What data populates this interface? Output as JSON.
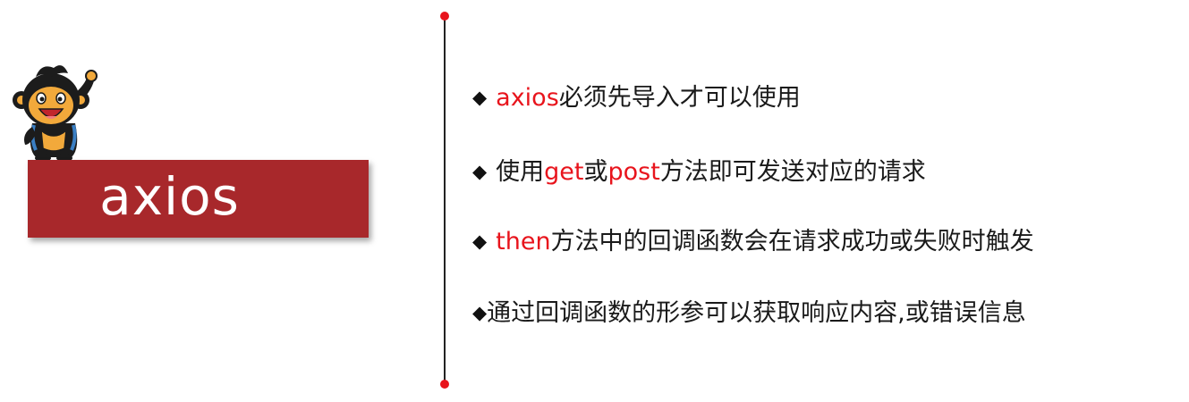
{
  "title": "axios",
  "bullets": [
    {
      "marker": "◆",
      "highlight": "axios",
      "text": "必须先导入才可以使用"
    },
    {
      "marker": "◆",
      "pre": "使用",
      "hl1": "get",
      "mid": "或",
      "hl2": "post",
      "post": "方法即可发送对应的请求"
    },
    {
      "marker": "◆",
      "highlight": "then",
      "text": "方法中的回调函数会在请求成功或失败时触发"
    },
    {
      "marker": "◆",
      "text": "通过回调函数的形参可以获取响应内容,或错误信息"
    }
  ],
  "colors": {
    "accent_red": "#e8141c",
    "banner": "#a8282b",
    "text": "#1a1a1a"
  },
  "icons": [
    "mascot-icon",
    "diamond-bullet-icon"
  ]
}
